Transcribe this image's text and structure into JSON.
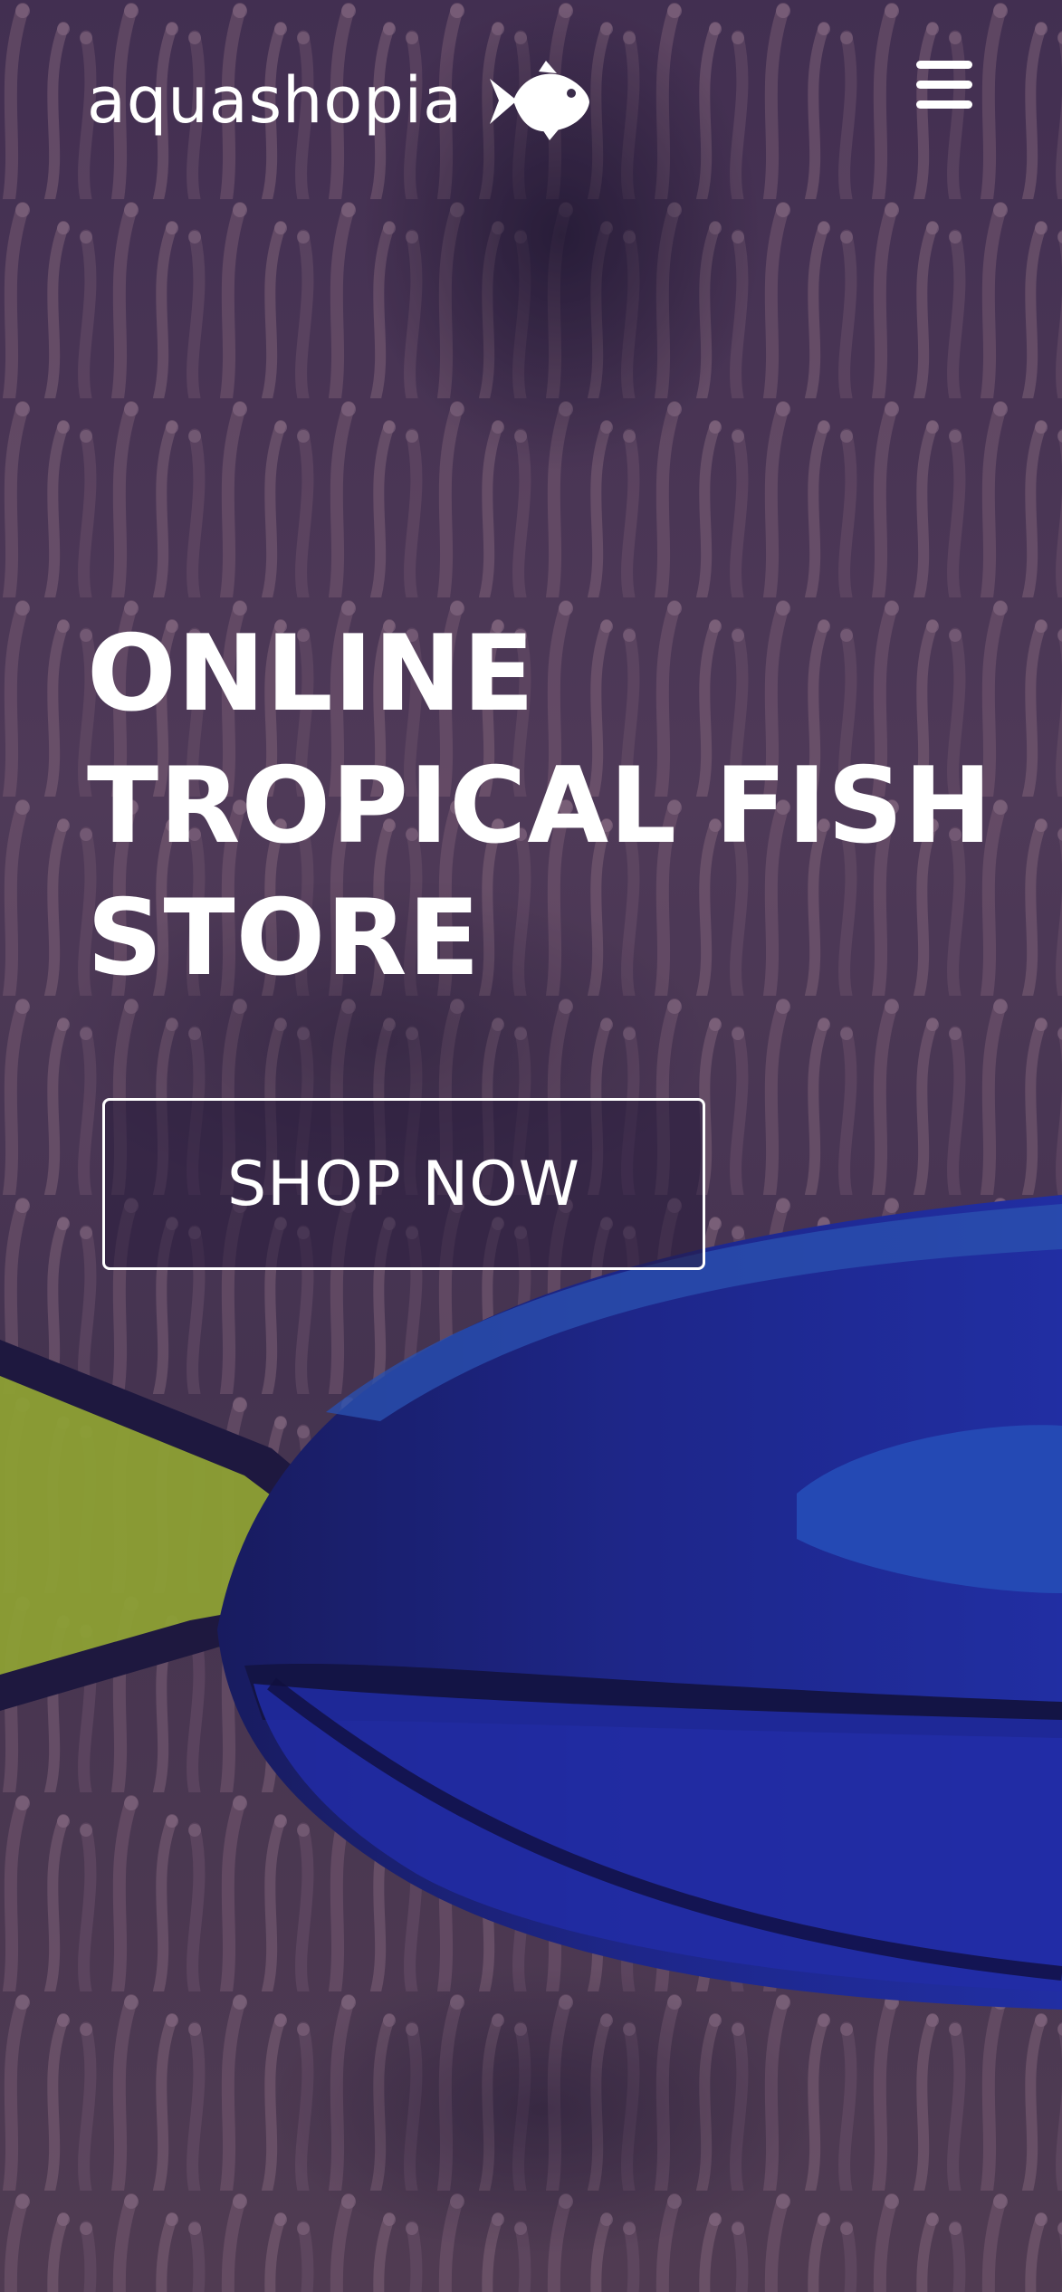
{
  "header": {
    "brand_name": "aquashopia",
    "brand_icon": "fish-icon",
    "menu_icon": "hamburger-menu-icon"
  },
  "hero": {
    "title_lines": [
      "ONLINE",
      "TROPICAL FISH",
      "STORE"
    ],
    "cta_label": "SHOP NOW",
    "background": "photo of a blue tang fish swimming in front of pink anemone coral"
  },
  "colors": {
    "text": "#ffffff",
    "overlay": "#3a2c4a",
    "fish_body": "#1a2a9a",
    "fish_tail": "#b6d632"
  }
}
